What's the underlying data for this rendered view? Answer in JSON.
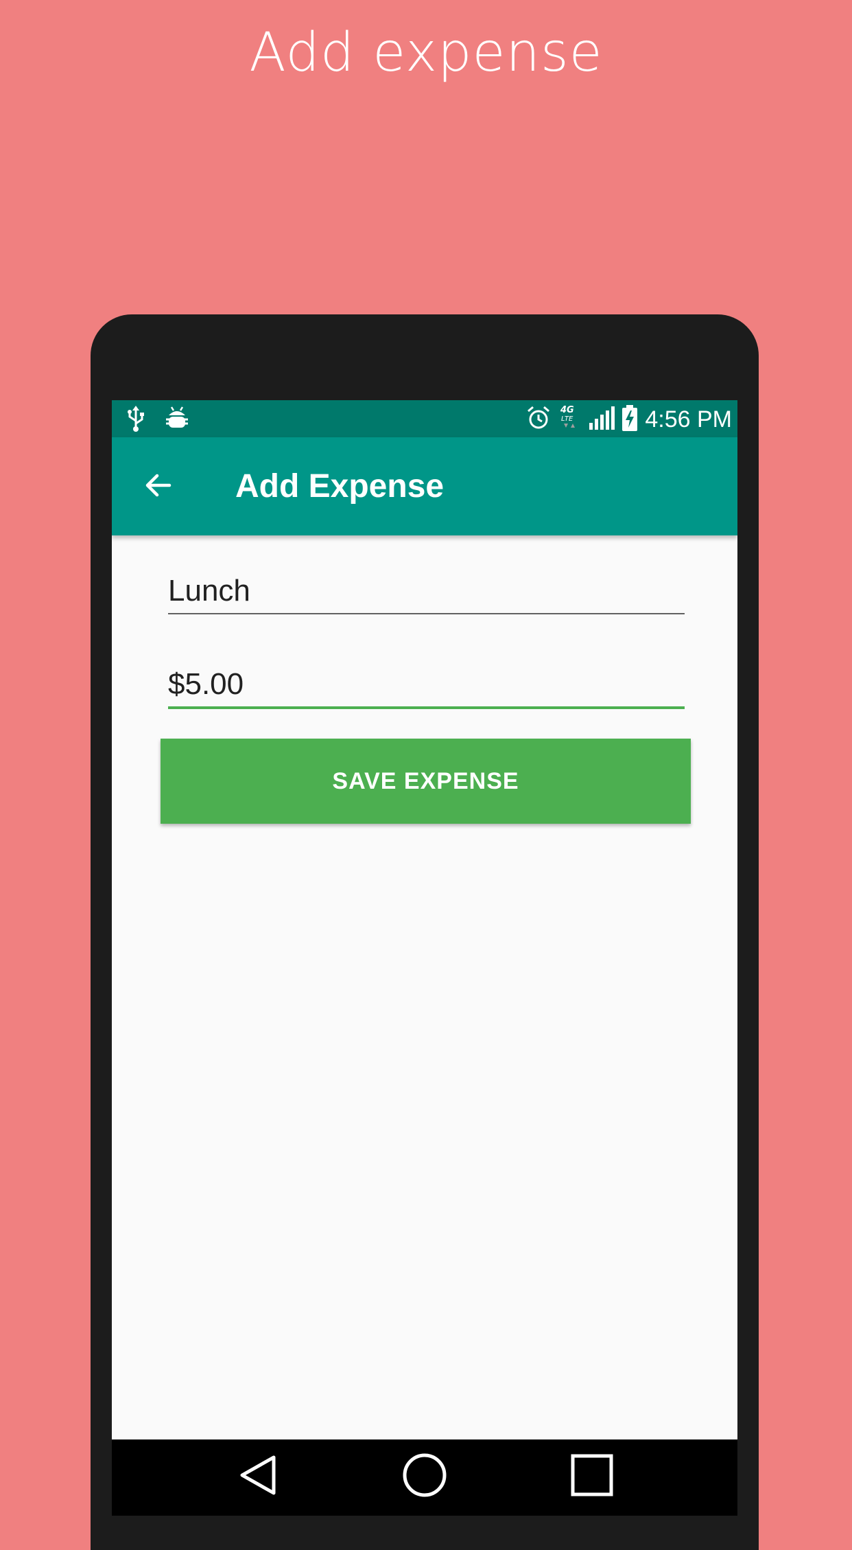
{
  "caption": "Add expense",
  "status_bar": {
    "time": "4:56 PM",
    "network": "4G LTE",
    "left_icons": [
      "usb-icon",
      "android-debug-icon"
    ],
    "right_icons": [
      "alarm-icon",
      "network-4g-lte-icon",
      "signal-icon",
      "battery-charging-icon"
    ]
  },
  "app_bar": {
    "back_icon": "arrow-back-icon",
    "title": "Add Expense"
  },
  "form": {
    "name_value": "Lunch",
    "amount_value": "$5.00",
    "save_label": "SAVE EXPENSE"
  },
  "nav_bar": {
    "buttons": [
      "back-triangle-icon",
      "home-circle-icon",
      "recents-square-icon"
    ]
  },
  "colors": {
    "background": "#F08080",
    "status_bar": "#00796B",
    "app_bar": "#009688",
    "accent": "#4CAF50",
    "screen": "#FAFAFA"
  }
}
